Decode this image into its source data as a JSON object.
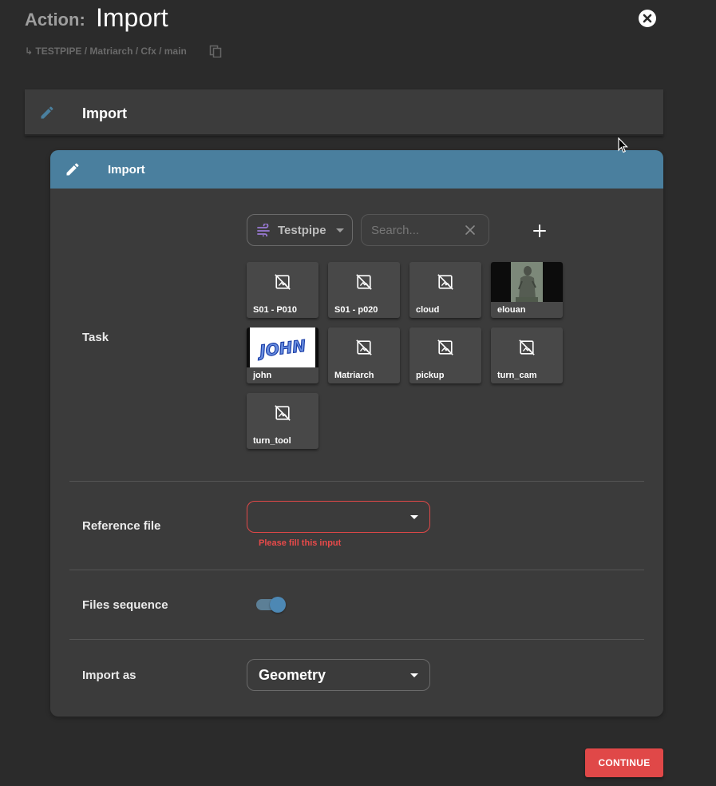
{
  "header": {
    "action_label": "Action:",
    "title": "Import",
    "breadcrumb": "↳ TESTPIPE / Matriarch / Cfx / main"
  },
  "outer_section": {
    "title": "Import"
  },
  "panel": {
    "title": "Import",
    "accent": "#4a7f9e",
    "task": {
      "label": "Task",
      "project_label": "Testpipe",
      "search_placeholder": "Search...",
      "tiles": [
        {
          "name": "S01 - P010",
          "thumb": "no-image-icon"
        },
        {
          "name": "S01 - p020",
          "thumb": "no-image-icon"
        },
        {
          "name": "cloud",
          "thumb": "no-image-icon"
        },
        {
          "name": "elouan",
          "thumb": "statue-thumbnail"
        },
        {
          "name": "john",
          "thumb": "john-logo-thumbnail",
          "thumb_text": "JOHN"
        },
        {
          "name": "Matriarch",
          "thumb": "no-image-icon"
        },
        {
          "name": "pickup",
          "thumb": "no-image-icon"
        },
        {
          "name": "turn_cam",
          "thumb": "no-image-icon"
        },
        {
          "name": "turn_tool",
          "thumb": "no-image-icon"
        }
      ]
    },
    "reference_file": {
      "label": "Reference file",
      "value": "",
      "error": "Please fill this input"
    },
    "files_sequence": {
      "label": "Files sequence",
      "enabled": true
    },
    "import_as": {
      "label": "Import as",
      "value": "Geometry"
    }
  },
  "footer": {
    "continue_label": "CONTINUE",
    "continue_color": "#e04848"
  }
}
